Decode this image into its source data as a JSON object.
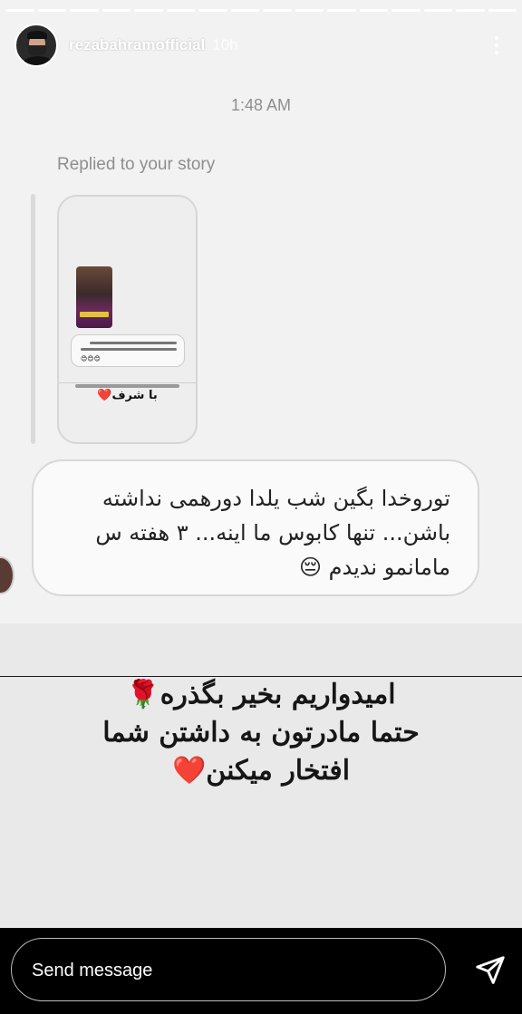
{
  "header": {
    "username": "rezabahramofficial",
    "time_ago": "10h",
    "progress_segments": 16
  },
  "thread": {
    "timestamp": "1:48 AM",
    "replied_label": "Replied to your story",
    "thumb_sticker": "با شرف❤️",
    "message_lines": [
      "توروخدا بگین شب یلدا دورهمی نداشته",
      "باشن... تنها کابوس ما اینه... ۳ هفته س",
      "مامانمو ندیدم 😔"
    ]
  },
  "reply_caption": {
    "lines": [
      "امیدواریم بخیر بگذره🌹",
      "حتما مادرتون به داشتن شما",
      "افتخار میکنن❤️"
    ]
  },
  "footer": {
    "send_placeholder": "Send message"
  },
  "icons": {
    "more": "more-vertical-icon",
    "send": "paper-plane-icon"
  }
}
